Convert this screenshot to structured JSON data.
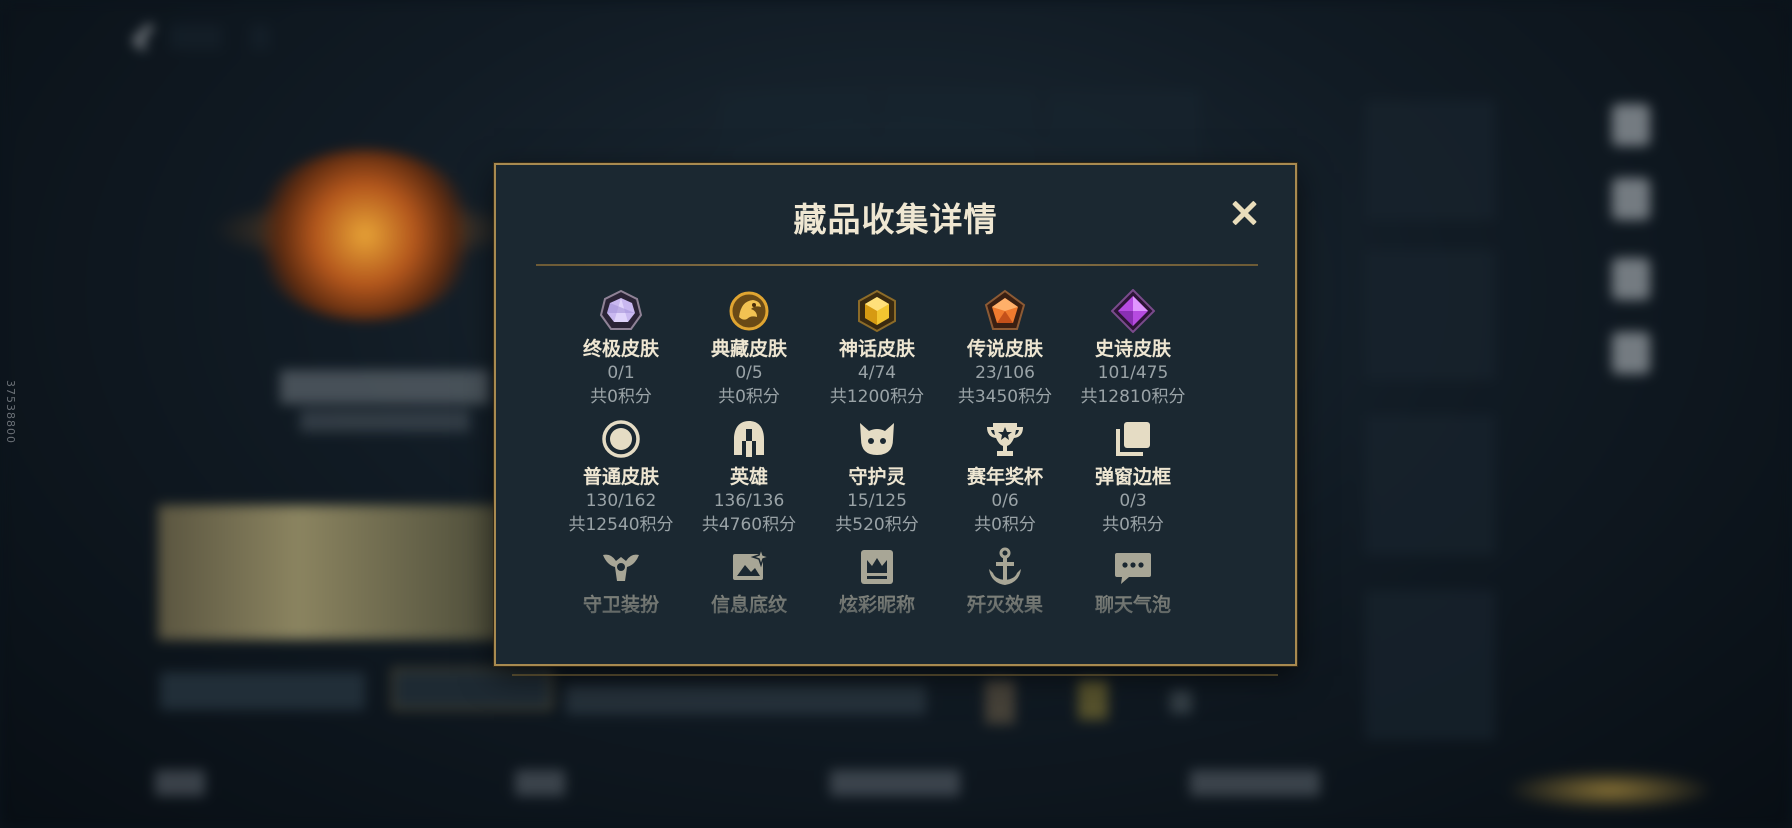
{
  "modal": {
    "title": "藏品收集详情",
    "close_icon": "close-icon"
  },
  "rows": [
    {
      "items": [
        {
          "label": "终极皮肤",
          "count": "0/1",
          "points": "共0积分",
          "icon": "ultimate-gem-icon",
          "color": "#c9b8f0"
        },
        {
          "label": "典藏皮肤",
          "count": "0/5",
          "points": "共0积分",
          "icon": "dragon-emblem-icon",
          "color": "#e0a531"
        },
        {
          "label": "神话皮肤",
          "count": "4/74",
          "points": "共1200积分",
          "icon": "mythic-gem-icon",
          "color": "#f2c530"
        },
        {
          "label": "传说皮肤",
          "count": "23/106",
          "points": "共3450积分",
          "icon": "legendary-gem-icon",
          "color": "#f07a2e"
        },
        {
          "label": "史诗皮肤",
          "count": "101/475",
          "points": "共12810积分",
          "icon": "epic-gem-icon",
          "color": "#b64be0"
        }
      ]
    },
    {
      "items": [
        {
          "label": "普通皮肤",
          "count": "130/162",
          "points": "共12540积分",
          "icon": "circle-badge-icon"
        },
        {
          "label": "英雄",
          "count": "136/136",
          "points": "共4760积分",
          "icon": "helmet-icon"
        },
        {
          "label": "守护灵",
          "count": "15/125",
          "points": "共520积分",
          "icon": "guardian-pet-icon"
        },
        {
          "label": "赛年奖杯",
          "count": "0/6",
          "points": "共0积分",
          "icon": "trophy-icon"
        },
        {
          "label": "弹窗边框",
          "count": "0/3",
          "points": "共0积分",
          "icon": "stacked-frames-icon"
        }
      ]
    },
    {
      "items": [
        {
          "label": "守卫装扮",
          "icon": "ward-skin-icon"
        },
        {
          "label": "信息底纹",
          "icon": "card-sparkle-icon"
        },
        {
          "label": "炫彩昵称",
          "icon": "crown-nameplate-icon"
        },
        {
          "label": "歼灭效果",
          "icon": "anchor-icon"
        },
        {
          "label": "聊天气泡",
          "icon": "chat-bubble-icon"
        }
      ]
    }
  ],
  "background": {
    "watermark": "37538800"
  }
}
